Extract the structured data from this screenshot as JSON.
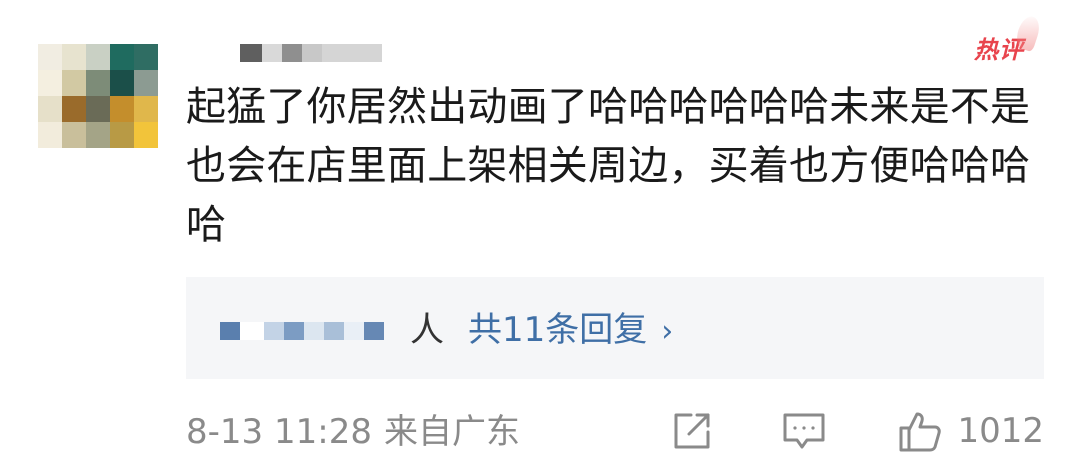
{
  "comment": {
    "hot_label": "热评",
    "text": "起猛了你居然出动画了哈哈哈哈哈哈未来是不是也会在店里面上架相关周边，买着也方便哈哈哈哈",
    "reply_summary": {
      "suffix": "人",
      "link_label": "共11条回复",
      "chevron": "›"
    },
    "meta": {
      "time": "8-13 11:28",
      "source": "来自广东"
    },
    "actions": {
      "share_icon": "share-icon",
      "reply_icon": "comment-icon",
      "like_icon": "thumbs-up-icon",
      "like_count": "1012"
    }
  },
  "colors": {
    "text": "#1a1a1a",
    "link": "#3f6fa6",
    "meta": "#8a8a8a",
    "hot": "#e8444d",
    "reply_bg": "#f5f6f8"
  }
}
